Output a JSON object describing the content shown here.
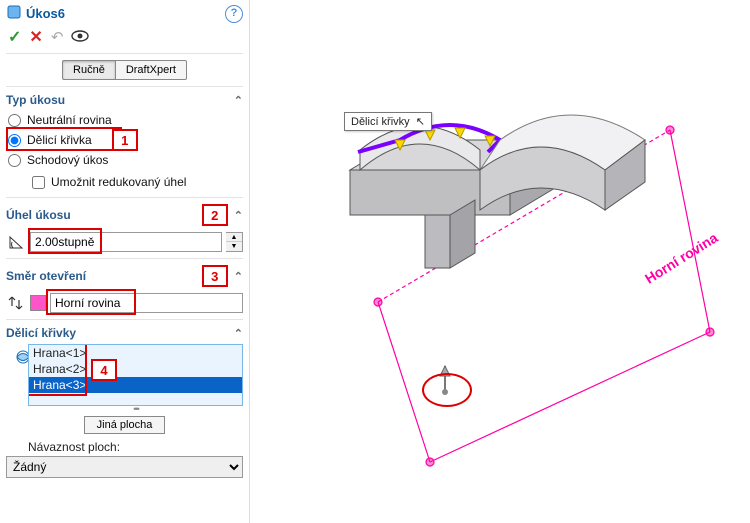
{
  "header": {
    "title": "Úkos6"
  },
  "tabs": {
    "manual": "Ručně",
    "draftxpert": "DraftXpert"
  },
  "type": {
    "heading": "Typ úkosu",
    "opt_neutral": "Neutrální rovina",
    "opt_parting": "Dělicí křivka",
    "opt_step": "Schodový úkos",
    "reduced_chk": "Umožnit redukovaný úhel"
  },
  "angle": {
    "heading": "Úhel úkosu",
    "value": "2.00stupně"
  },
  "direction": {
    "heading": "Směr otevření",
    "value": "Horní rovina"
  },
  "parting": {
    "heading": "Dělicí křivky",
    "edges": [
      "Hrana<1>",
      "Hrana<2>",
      "Hrana<3>"
    ],
    "other_faces_btn": "Jiná plocha",
    "continuity_label": "Návaznost ploch:",
    "continuity_value": "Žádný"
  },
  "markers": {
    "m1": "1",
    "m2": "2",
    "m3": "3",
    "m4": "4"
  },
  "viewport": {
    "tooltip": "Dělicí křivky",
    "plane_label": "Horní rovina"
  }
}
